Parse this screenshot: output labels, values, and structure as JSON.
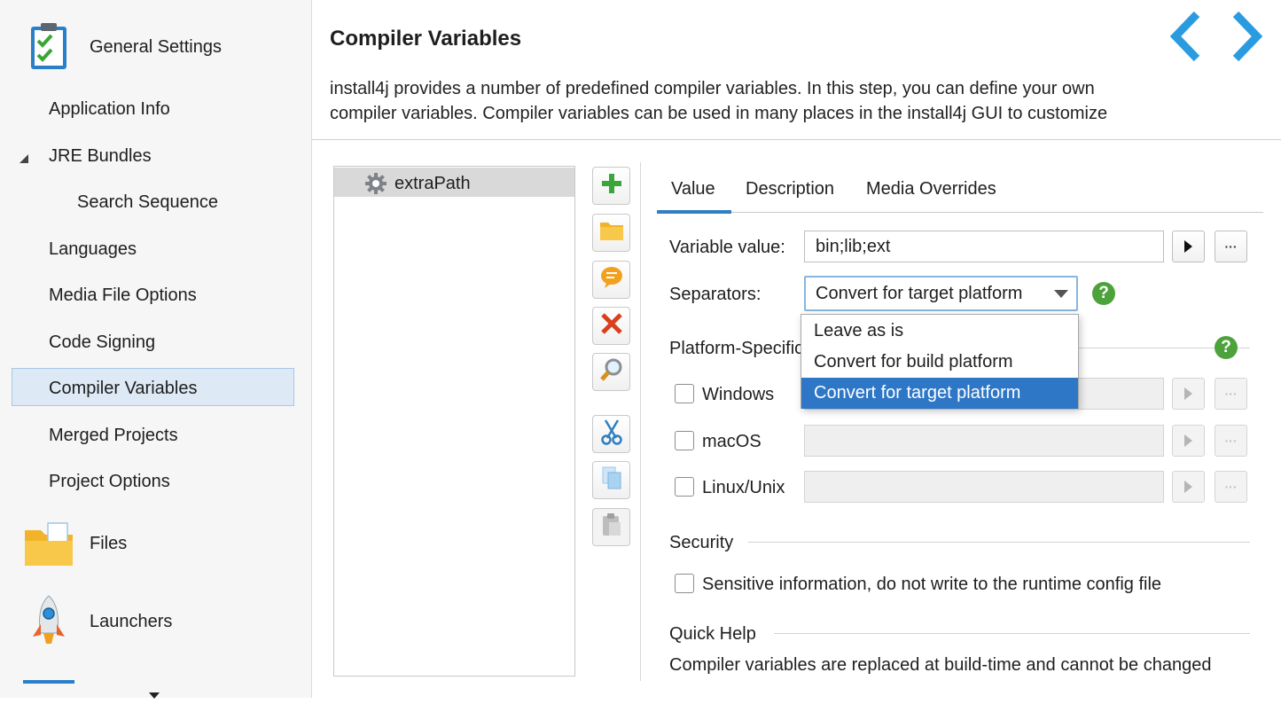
{
  "sidebar": {
    "general_settings": "General Settings",
    "items": [
      {
        "label": "Application Info"
      },
      {
        "label": "JRE Bundles"
      },
      {
        "label": "Search Sequence"
      },
      {
        "label": "Languages"
      },
      {
        "label": "Media File Options"
      },
      {
        "label": "Code Signing"
      },
      {
        "label": "Compiler Variables"
      },
      {
        "label": "Merged Projects"
      },
      {
        "label": "Project Options"
      }
    ],
    "files": "Files",
    "launchers": "Launchers"
  },
  "header": {
    "title": "Compiler Variables",
    "description": "install4j provides a number of predefined compiler variables. In this step, you can define your own compiler variables. Compiler variables can be used in many places in the install4j GUI to customize"
  },
  "variables": {
    "items": [
      {
        "name": "extraPath"
      }
    ]
  },
  "tabs": [
    {
      "label": "Value"
    },
    {
      "label": "Description"
    },
    {
      "label": "Media Overrides"
    }
  ],
  "form": {
    "variable_value_label": "Variable value:",
    "variable_value": "bin;lib;ext",
    "separators_label": "Separators:",
    "separators_selected": "Convert for target platform",
    "separators_options": [
      "Leave as is",
      "Convert for build platform",
      "Convert for target platform"
    ],
    "platform_specific_label": "Platform-Specific",
    "platforms": [
      {
        "label": "Windows"
      },
      {
        "label": "macOS"
      },
      {
        "label": "Linux/Unix"
      }
    ],
    "security_label": "Security",
    "sensitive_label": "Sensitive information, do not write to the runtime config file",
    "quick_help_label": "Quick Help",
    "quick_help_text": "Compiler variables are replaced at build-time and cannot be changed",
    "help_glyph": "?",
    "dots": "···"
  },
  "colors": {
    "accent": "#2e77c6",
    "help_green": "#4da33b",
    "nav_arrow": "#2b9be0"
  }
}
